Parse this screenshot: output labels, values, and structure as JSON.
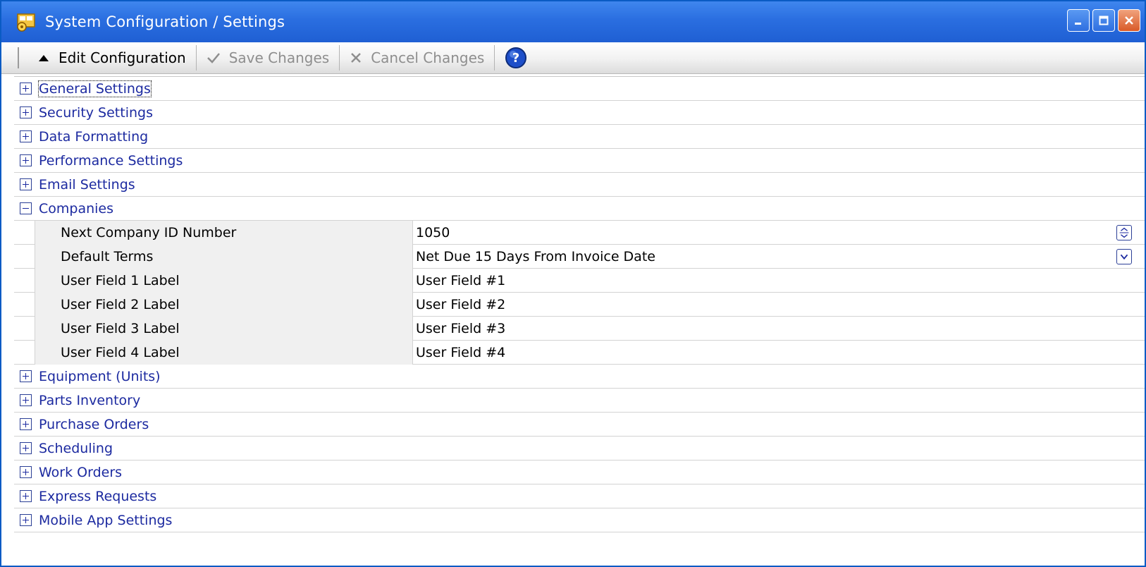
{
  "window": {
    "title": "System Configuration / Settings",
    "icon": "settings-window-icon",
    "buttons": [
      "minimize",
      "maximize",
      "close"
    ],
    "accent_color": "#1f5fd3"
  },
  "toolbar": {
    "edit_label": "Edit Configuration",
    "save_label": "Save Changes",
    "cancel_label": "Cancel Changes",
    "help_icon": "help-icon",
    "save_enabled": false,
    "cancel_enabled": false
  },
  "categories": [
    {
      "label": "General Settings",
      "expanded": false
    },
    {
      "label": "Security Settings",
      "expanded": false
    },
    {
      "label": "Data Formatting",
      "expanded": false
    },
    {
      "label": "Performance Settings",
      "expanded": false
    },
    {
      "label": "Email Settings",
      "expanded": false
    },
    {
      "label": "Companies",
      "expanded": true
    },
    {
      "label": "Equipment (Units)",
      "expanded": false
    },
    {
      "label": "Parts Inventory",
      "expanded": false
    },
    {
      "label": "Purchase Orders",
      "expanded": false
    },
    {
      "label": "Scheduling",
      "expanded": false
    },
    {
      "label": "Work Orders",
      "expanded": false
    },
    {
      "label": "Express Requests",
      "expanded": false
    },
    {
      "label": "Mobile App Settings",
      "expanded": false
    }
  ],
  "companies": {
    "properties": [
      {
        "name": "Next Company ID Number",
        "value": "1050",
        "editor": "spin"
      },
      {
        "name": "Default Terms",
        "value": "Net Due 15 Days From Invoice Date",
        "editor": "dropdown"
      },
      {
        "name": "User Field 1 Label",
        "value": "User Field #1"
      },
      {
        "name": "User Field 2 Label",
        "value": "User Field #2"
      },
      {
        "name": "User Field 3 Label",
        "value": "User Field #3"
      },
      {
        "name": "User Field 4 Label",
        "value": "User Field #4"
      }
    ]
  }
}
